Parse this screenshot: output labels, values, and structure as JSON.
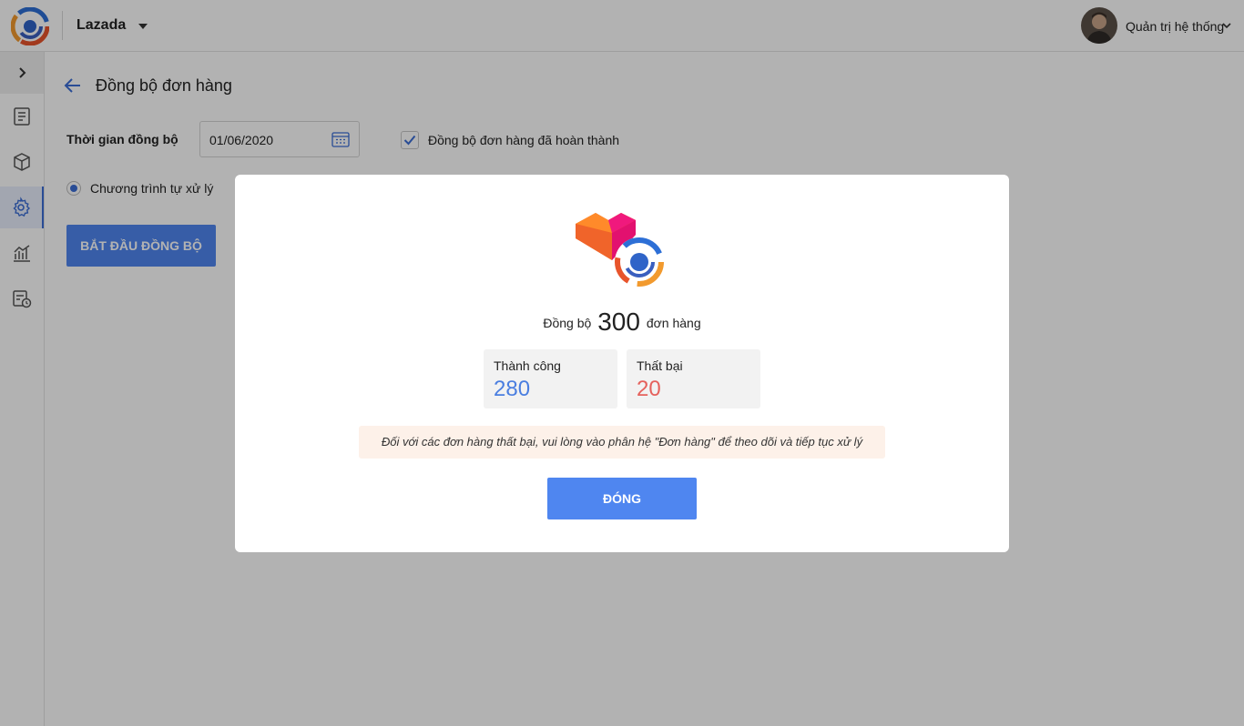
{
  "topbar": {
    "shop_name": "Lazada",
    "user_name": "Quản trị hệ thống"
  },
  "sidebar": {
    "items": [
      {
        "icon": "document-icon"
      },
      {
        "icon": "box-icon"
      },
      {
        "icon": "gear-icon",
        "active": true
      },
      {
        "icon": "chart-icon"
      },
      {
        "icon": "schedule-icon"
      }
    ]
  },
  "page": {
    "title": "Đồng bộ đơn hàng",
    "time_label": "Thời gian đồng bộ",
    "date_value": "01/06/2020",
    "checkbox_label": "Đồng bộ đơn hàng đã hoàn thành",
    "checkbox_checked": true,
    "radio_label": "Chương trình tự xử lý",
    "start_button": "BẮT ĐẦU ĐỒNG BỘ"
  },
  "modal": {
    "summary_prefix": "Đồng bộ",
    "total": "300",
    "summary_suffix": "đơn hàng",
    "success_label": "Thành công",
    "success_value": "280",
    "fail_label": "Thất bại",
    "fail_value": "20",
    "note": "Đối với các đơn hàng thất bại, vui lòng vào phân hệ \"Đơn hàng\" để theo dõi và tiếp tục xử lý",
    "close_button": "ĐÓNG"
  },
  "colors": {
    "primary": "#4f86f0",
    "success": "#4a7ee0",
    "fail": "#e5615c",
    "note_bg": "#fdf1e9"
  }
}
